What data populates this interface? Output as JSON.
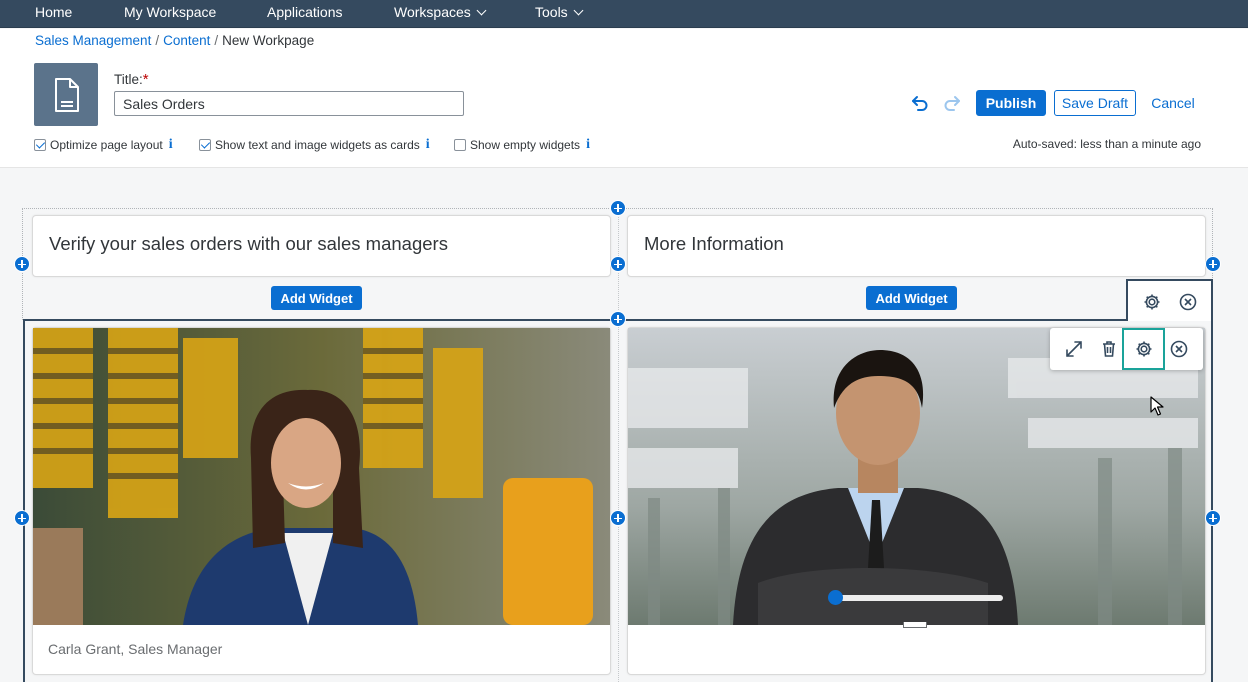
{
  "nav": {
    "items": [
      {
        "label": "Home",
        "has_dropdown": false
      },
      {
        "label": "My Workspace",
        "has_dropdown": false
      },
      {
        "label": "Applications",
        "has_dropdown": false
      },
      {
        "label": "Workspaces",
        "has_dropdown": true
      },
      {
        "label": "Tools",
        "has_dropdown": true
      }
    ],
    "background": "#354a5f"
  },
  "breadcrumb": {
    "links": [
      "Sales Management",
      "Content"
    ],
    "current": "New Workpage",
    "separator": "/"
  },
  "header": {
    "icon": "document-icon",
    "title_label": "Title:",
    "required_mark": "*",
    "title_value": "Sales Orders",
    "undo_icon": "undo-icon",
    "redo_icon": "redo-icon",
    "publish_label": "Publish",
    "save_draft_label": "Save Draft",
    "cancel_label": "Cancel",
    "options": [
      {
        "label": "Optimize page layout",
        "checked": true
      },
      {
        "label": "Show text and image widgets as cards",
        "checked": true
      },
      {
        "label": "Show empty widgets",
        "checked": false
      }
    ],
    "info_glyph": "i",
    "autosave_text": "Auto-saved: less than a minute ago"
  },
  "section1": {
    "left_card_title": "Verify your sales orders with our sales managers",
    "right_card_title": "More Information",
    "add_widget_label": "Add Widget"
  },
  "section2": {
    "toolbar_icons": [
      "gear-icon",
      "close-circle-icon"
    ],
    "left_caption": "Carla Grant, Sales Manager",
    "widget_toolbar_icons": [
      "expand-icon",
      "trash-icon",
      "gear-icon",
      "close-circle-icon"
    ],
    "image_resize_slider_value": 0.0
  },
  "colors": {
    "accent": "#0a6ed1",
    "section_border": "#354a5f",
    "highlight": "#1aa39a"
  }
}
